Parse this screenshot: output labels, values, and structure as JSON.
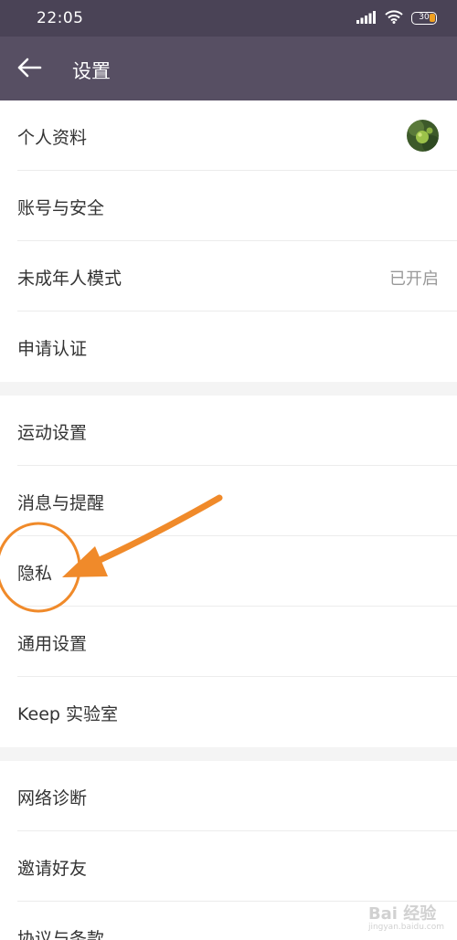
{
  "status_bar": {
    "time": "22:05",
    "battery": "30",
    "icons": [
      "signal-icon",
      "wifi-icon",
      "battery-icon"
    ]
  },
  "app_bar": {
    "back_icon": "arrow-left-icon",
    "title": "设置"
  },
  "colors": {
    "status_bar_bg": "#4a4356",
    "app_bar_bg": "#574f63",
    "annotation_orange": "#f08a2a",
    "row_text": "#333333",
    "value_text": "#999999"
  },
  "groups": [
    {
      "items": [
        {
          "label": "个人资料",
          "type": "avatar"
        },
        {
          "label": "账号与安全"
        },
        {
          "label": "未成年人模式",
          "value": "已开启"
        },
        {
          "label": "申请认证"
        }
      ]
    },
    {
      "items": [
        {
          "label": "运动设置"
        },
        {
          "label": "消息与提醒"
        },
        {
          "label": "隐私"
        },
        {
          "label": "通用设置"
        },
        {
          "label": "Keep 实验室"
        }
      ]
    },
    {
      "items": [
        {
          "label": "网络诊断"
        },
        {
          "label": "邀请好友"
        },
        {
          "label": "协议与条款"
        }
      ]
    }
  ],
  "annotation": {
    "shapes": [
      "circle-highlight",
      "arrow-pointer"
    ],
    "highlighted_item": "隐私"
  },
  "watermark": {
    "text": "Bai 经验",
    "subtext": "jingyan.baidu.com"
  }
}
